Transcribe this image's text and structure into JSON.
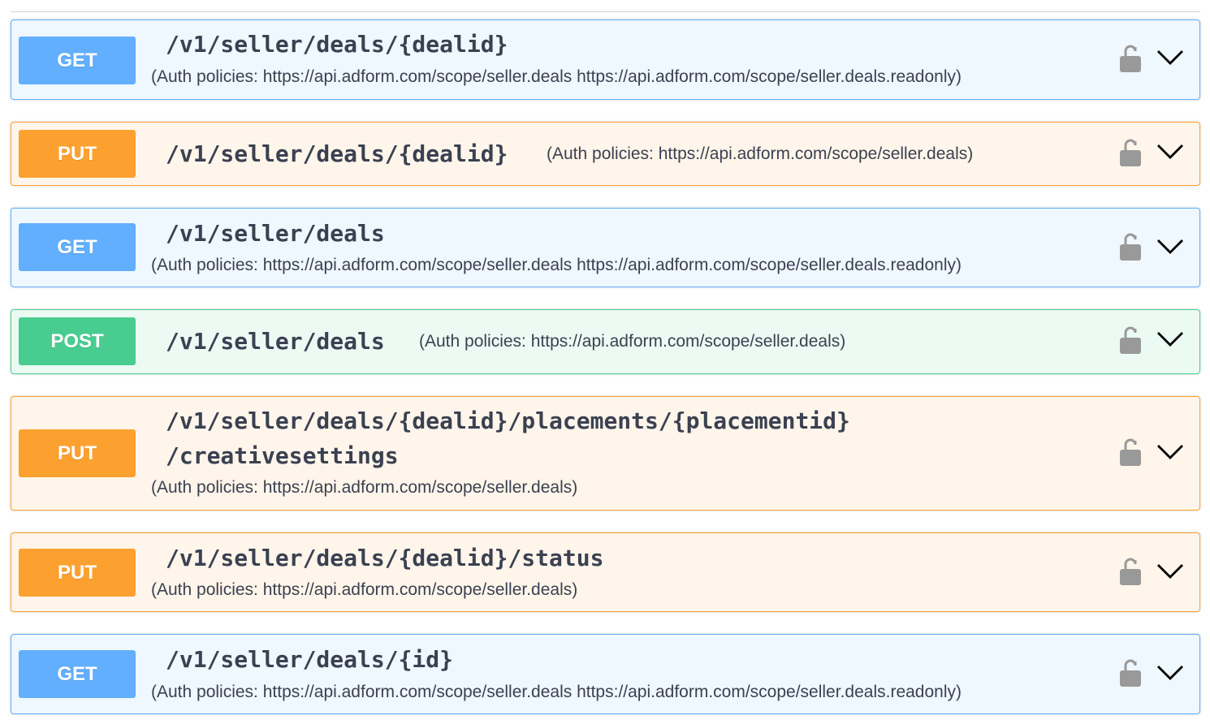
{
  "operations": [
    {
      "method": "GET",
      "path": "/v1/seller/deals/{dealid}",
      "auth": "(Auth policies: https://api.adform.com/scope/seller.deals https://api.adform.com/scope/seller.deals.readonly)"
    },
    {
      "method": "PUT",
      "path": "/v1/seller/deals/{dealid}",
      "auth": "(Auth policies: https://api.adform.com/scope/seller.deals)"
    },
    {
      "method": "GET",
      "path": "/v1/seller/deals",
      "auth": "(Auth policies: https://api.adform.com/scope/seller.deals https://api.adform.com/scope/seller.deals.readonly)"
    },
    {
      "method": "POST",
      "path": "/v1/seller/deals",
      "auth": "(Auth policies: https://api.adform.com/scope/seller.deals)"
    },
    {
      "method": "PUT",
      "path_line1": "/v1/seller/deals/{dealid}/placements/{placementid}",
      "path_line2": "/creativesettings",
      "auth": "(Auth policies: https://api.adform.com/scope/seller.deals)"
    },
    {
      "method": "PUT",
      "path": "/v1/seller/deals/{dealid}/status",
      "auth": "(Auth policies: https://api.adform.com/scope/seller.deals)"
    },
    {
      "method": "GET",
      "path": "/v1/seller/deals/{id}",
      "auth": "(Auth policies: https://api.adform.com/scope/seller.deals https://api.adform.com/scope/seller.deals.readonly)"
    }
  ],
  "icons": {
    "lock": "lock-icon",
    "expand": "chevron-down-icon"
  },
  "colors": {
    "get": "#61affe",
    "put": "#fca130",
    "post": "#49cc90",
    "text": "#3b4151",
    "icon": "#999999"
  }
}
